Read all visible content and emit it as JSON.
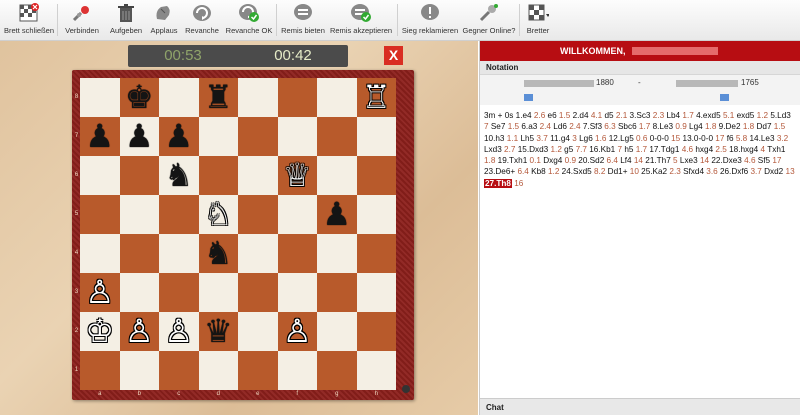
{
  "toolbar": {
    "items": [
      {
        "label": "Brett schließen",
        "icon": "close-board-icon"
      },
      {
        "label": "Verbinden",
        "icon": "connect-icon"
      },
      {
        "label": "Aufgeben",
        "icon": "trash-icon"
      },
      {
        "label": "Applaus",
        "icon": "applause-icon"
      },
      {
        "label": "Revanche",
        "icon": "revanche-icon"
      },
      {
        "label": "Revanche OK",
        "icon": "revanche-ok-icon"
      },
      {
        "label": "Remis bieten",
        "icon": "draw-offer-icon"
      },
      {
        "label": "Remis akzeptieren",
        "icon": "draw-accept-icon"
      },
      {
        "label": "Sieg reklamieren",
        "icon": "claim-win-icon"
      },
      {
        "label": "Gegner Online?",
        "icon": "opponent-online-icon"
      },
      {
        "label": "Bretter",
        "icon": "boards-icon"
      }
    ]
  },
  "clock": {
    "white_time": "00:53",
    "black_time": "00:42"
  },
  "close_label": "X",
  "board": {
    "files": [
      "a",
      "b",
      "c",
      "d",
      "e",
      "f",
      "g",
      "h"
    ],
    "ranks": [
      "8",
      "7",
      "6",
      "5",
      "4",
      "3",
      "2",
      "1"
    ],
    "pieces": [
      {
        "square": "b8",
        "glyph": "♚",
        "color": "black"
      },
      {
        "square": "d8",
        "glyph": "♜",
        "color": "black"
      },
      {
        "square": "h8",
        "glyph": "♖",
        "color": "white"
      },
      {
        "square": "a7",
        "glyph": "♟",
        "color": "black"
      },
      {
        "square": "b7",
        "glyph": "♟",
        "color": "black"
      },
      {
        "square": "c7",
        "glyph": "♟",
        "color": "black"
      },
      {
        "square": "c6",
        "glyph": "♞",
        "color": "black"
      },
      {
        "square": "f6",
        "glyph": "♕",
        "color": "white"
      },
      {
        "square": "d5",
        "glyph": "♘",
        "color": "white"
      },
      {
        "square": "g5",
        "glyph": "♟",
        "color": "black"
      },
      {
        "square": "d4",
        "glyph": "♞",
        "color": "black"
      },
      {
        "square": "a3",
        "glyph": "♙",
        "color": "white"
      },
      {
        "square": "a2",
        "glyph": "♔",
        "color": "white"
      },
      {
        "square": "b2",
        "glyph": "♙",
        "color": "white"
      },
      {
        "square": "c2",
        "glyph": "♙",
        "color": "white"
      },
      {
        "square": "d2",
        "glyph": "♛",
        "color": "black"
      },
      {
        "square": "f2",
        "glyph": "♙",
        "color": "white"
      }
    ]
  },
  "panel": {
    "welcome": "WILLKOMMEN, ",
    "notation_label": "Notation",
    "white_rating": "1880",
    "dash": "-",
    "black_rating": "1765",
    "chat_label": "Chat"
  },
  "moves": [
    {
      "t": "3m + 0s",
      "c": "tx"
    },
    {
      "t": "1.e4",
      "c": "mv"
    },
    {
      "t": "2.6",
      "c": "tm"
    },
    {
      "t": "e6",
      "c": "mv"
    },
    {
      "t": "1.5",
      "c": "tm"
    },
    {
      "t": "2.d4",
      "c": "mv"
    },
    {
      "t": "4.1",
      "c": "tm"
    },
    {
      "t": "d5",
      "c": "mv"
    },
    {
      "t": "2.1",
      "c": "tm"
    },
    {
      "t": "3.Sc3",
      "c": "mv"
    },
    {
      "t": "2.3",
      "c": "tm"
    },
    {
      "t": "Lb4",
      "c": "mv"
    },
    {
      "t": "1.7",
      "c": "tm"
    },
    {
      "t": "4.exd5",
      "c": "mv"
    },
    {
      "t": "5.1",
      "c": "tm"
    },
    {
      "t": "exd5",
      "c": "mv"
    },
    {
      "t": "1.2",
      "c": "tm"
    },
    {
      "t": "5.Ld3",
      "c": "mv"
    },
    {
      "t": "7",
      "c": "tm"
    },
    {
      "t": "Se7",
      "c": "mv"
    },
    {
      "t": "1.5",
      "c": "tm"
    },
    {
      "t": "6.a3",
      "c": "mv"
    },
    {
      "t": "2.4",
      "c": "tm"
    },
    {
      "t": "Ld6",
      "c": "mv"
    },
    {
      "t": "2.4",
      "c": "tm"
    },
    {
      "t": "7.Sf3",
      "c": "mv"
    },
    {
      "t": "6.3",
      "c": "tm"
    },
    {
      "t": "Sbc6",
      "c": "mv"
    },
    {
      "t": "1.7",
      "c": "tm"
    },
    {
      "t": "8.Le3",
      "c": "mv"
    },
    {
      "t": "0.9",
      "c": "tm"
    },
    {
      "t": "Lg4",
      "c": "mv"
    },
    {
      "t": "1.8",
      "c": "tm"
    },
    {
      "t": "9.De2",
      "c": "mv"
    },
    {
      "t": "1.8",
      "c": "tm"
    },
    {
      "t": "Dd7",
      "c": "mv"
    },
    {
      "t": "1.5",
      "c": "tm"
    },
    {
      "t": "10.h3",
      "c": "mv"
    },
    {
      "t": "1.1",
      "c": "tm"
    },
    {
      "t": "Lh5",
      "c": "mv"
    },
    {
      "t": "3.7",
      "c": "tm"
    },
    {
      "t": "11.g4",
      "c": "mv"
    },
    {
      "t": "3",
      "c": "tm"
    },
    {
      "t": "Lg6",
      "c": "mv"
    },
    {
      "t": "1.6",
      "c": "tm"
    },
    {
      "t": "12.Lg5",
      "c": "mv"
    },
    {
      "t": "0.6",
      "c": "tm"
    },
    {
      "t": "0-0-0",
      "c": "mv"
    },
    {
      "t": "15",
      "c": "tm"
    },
    {
      "t": "13.0-0-0",
      "c": "mv"
    },
    {
      "t": "17",
      "c": "tm"
    },
    {
      "t": "f6",
      "c": "mv"
    },
    {
      "t": "5.8",
      "c": "tm"
    },
    {
      "t": "14.Le3",
      "c": "mv"
    },
    {
      "t": "3.2",
      "c": "tm"
    },
    {
      "t": "Lxd3",
      "c": "mv"
    },
    {
      "t": "2.7",
      "c": "tm"
    },
    {
      "t": "15.Dxd3",
      "c": "mv"
    },
    {
      "t": "1.2",
      "c": "tm"
    },
    {
      "t": "g5",
      "c": "mv"
    },
    {
      "t": "7.7",
      "c": "tm"
    },
    {
      "t": "16.Kb1",
      "c": "mv"
    },
    {
      "t": "7",
      "c": "tm"
    },
    {
      "t": "h5",
      "c": "mv"
    },
    {
      "t": "1.7",
      "c": "tm"
    },
    {
      "t": "17.Tdg1",
      "c": "mv"
    },
    {
      "t": "4.6",
      "c": "tm"
    },
    {
      "t": "hxg4",
      "c": "mv"
    },
    {
      "t": "2.5",
      "c": "tm"
    },
    {
      "t": "18.hxg4",
      "c": "mv"
    },
    {
      "t": "4",
      "c": "tm"
    },
    {
      "t": "Txh1",
      "c": "mv"
    },
    {
      "t": "1.8",
      "c": "tm"
    },
    {
      "t": "19.Txh1",
      "c": "mv"
    },
    {
      "t": "0.1",
      "c": "tm"
    },
    {
      "t": "Dxg4",
      "c": "mv"
    },
    {
      "t": "0.9",
      "c": "tm"
    },
    {
      "t": "20.Sd2",
      "c": "mv"
    },
    {
      "t": "6.4",
      "c": "tm"
    },
    {
      "t": "Lf4",
      "c": "mv"
    },
    {
      "t": "14",
      "c": "tm"
    },
    {
      "t": "21.Th7",
      "c": "mv"
    },
    {
      "t": "5",
      "c": "tm"
    },
    {
      "t": "Lxe3",
      "c": "mv"
    },
    {
      "t": "14",
      "c": "tm"
    },
    {
      "t": "22.Dxe3",
      "c": "mv"
    },
    {
      "t": "4.6",
      "c": "tm"
    },
    {
      "t": "Sf5",
      "c": "mv"
    },
    {
      "t": "17",
      "c": "tm"
    },
    {
      "t": "23.De6+",
      "c": "mv"
    },
    {
      "t": "6.4",
      "c": "tm"
    },
    {
      "t": "Kb8",
      "c": "mv"
    },
    {
      "t": "1.2",
      "c": "tm"
    },
    {
      "t": "24.Sxd5",
      "c": "mv"
    },
    {
      "t": "8.2",
      "c": "tm"
    },
    {
      "t": "Dd1+",
      "c": "mv"
    },
    {
      "t": "10",
      "c": "tm"
    },
    {
      "t": "25.Ka2",
      "c": "mv"
    },
    {
      "t": "2.3",
      "c": "tm"
    },
    {
      "t": "Sfxd4",
      "c": "mv"
    },
    {
      "t": "3.6",
      "c": "tm"
    },
    {
      "t": "26.Dxf6",
      "c": "mv"
    },
    {
      "t": "3.7",
      "c": "tm"
    },
    {
      "t": "Dxd2",
      "c": "mv"
    },
    {
      "t": "13",
      "c": "tm"
    },
    {
      "t": "27.Th8",
      "c": "cur"
    },
    {
      "t": "16",
      "c": "tm"
    }
  ]
}
